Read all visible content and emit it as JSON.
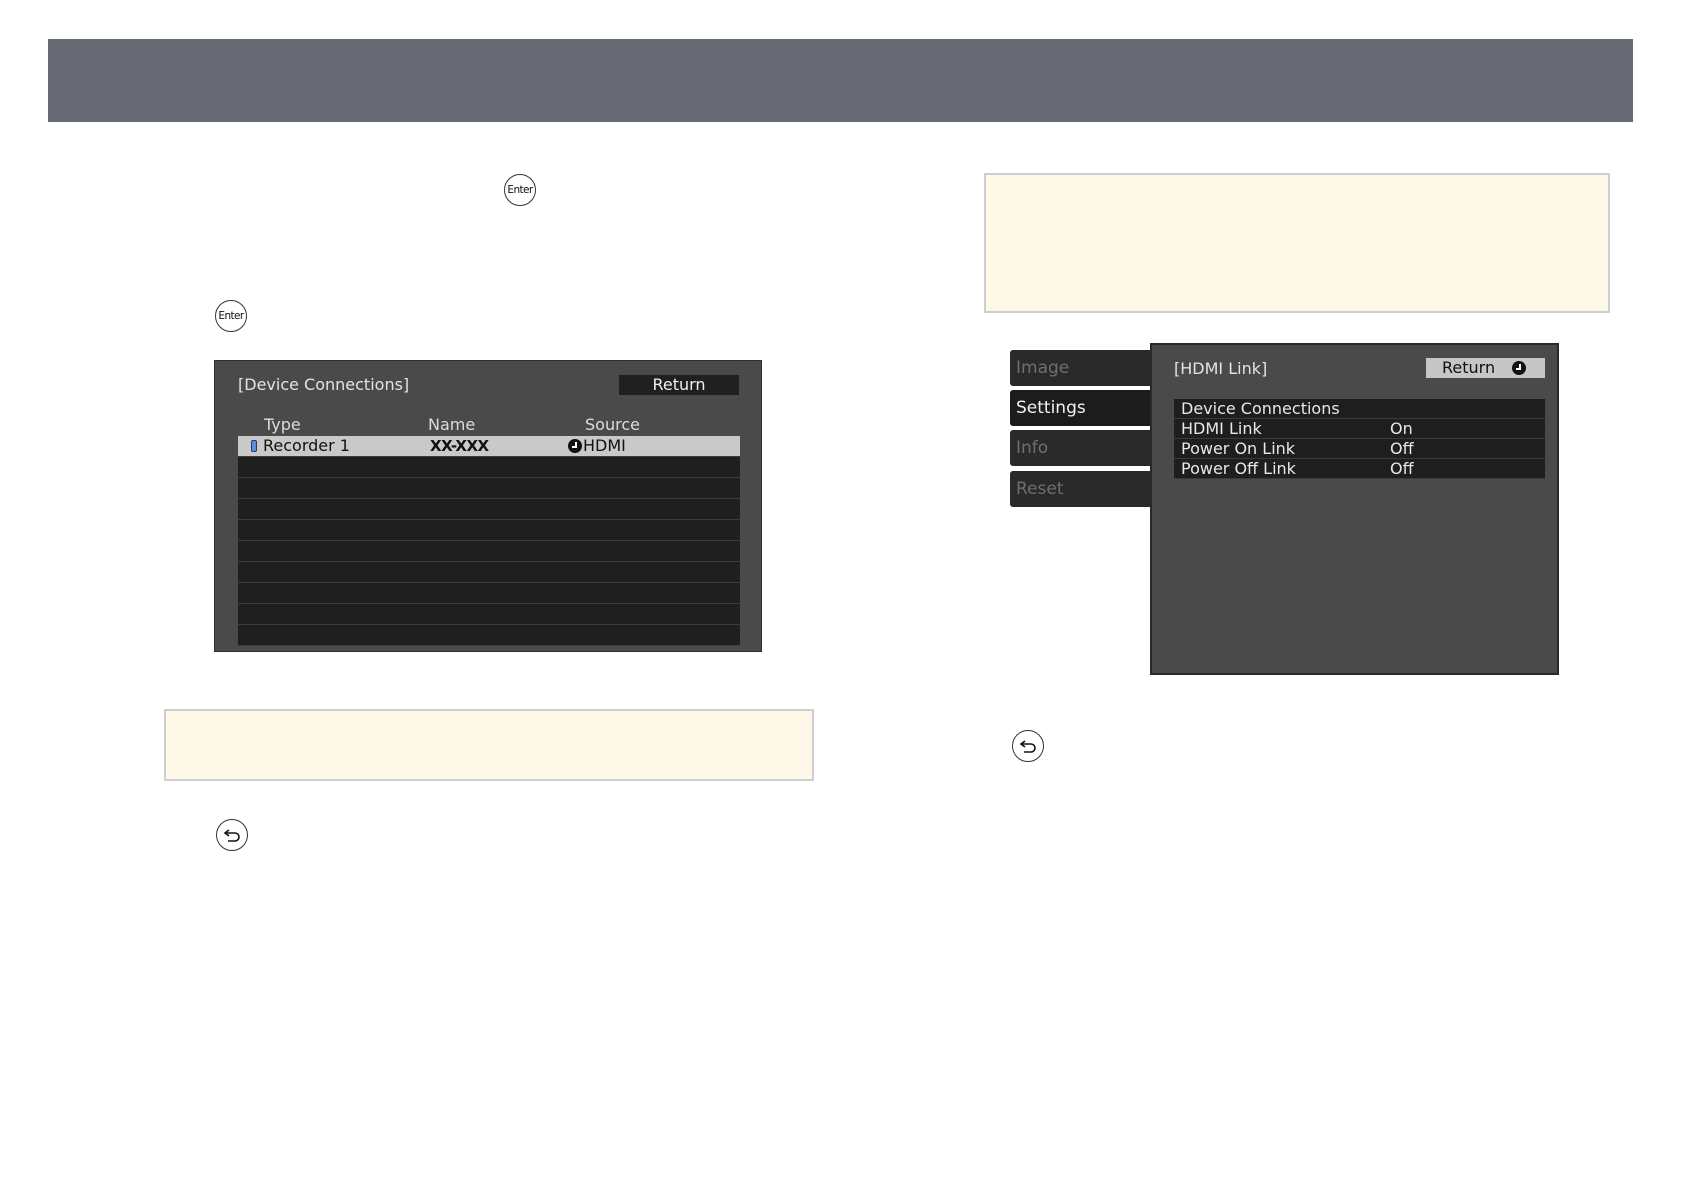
{
  "header": {
    "title": ""
  },
  "buttons": {
    "enter_label": "Enter"
  },
  "device_connections": {
    "title": "[Device Connections]",
    "return_label": "Return",
    "columns": [
      "Type",
      "Name",
      "Source"
    ],
    "rows": [
      {
        "type": "Recorder 1",
        "name": "XX-XXX",
        "source": "HDMI",
        "selected": true
      }
    ],
    "empty_row_count": 9
  },
  "settings_menu": {
    "tabs": [
      {
        "label": "Image",
        "active": false
      },
      {
        "label": "Settings",
        "active": true
      },
      {
        "label": "Info",
        "active": false
      },
      {
        "label": "Reset",
        "active": false
      }
    ],
    "panel_title": "[HDMI Link]",
    "return_label": "Return",
    "items": [
      {
        "label": "Device Connections",
        "value": ""
      },
      {
        "label": "HDMI Link",
        "value": "On"
      },
      {
        "label": "Power On Link",
        "value": "Off"
      },
      {
        "label": "Power Off Link",
        "value": "Off"
      }
    ]
  },
  "icons": {
    "enter_button": "enter-button-icon",
    "return_button": "return-arrow-icon",
    "source_indicator": "enter-arrow-icon",
    "device_type": "recorder-icon"
  },
  "colors": {
    "header": "#676a72",
    "note_background": "#fdf8e8",
    "menu_background": "#4a4a4a",
    "selected_row": "#c9c9c9"
  }
}
